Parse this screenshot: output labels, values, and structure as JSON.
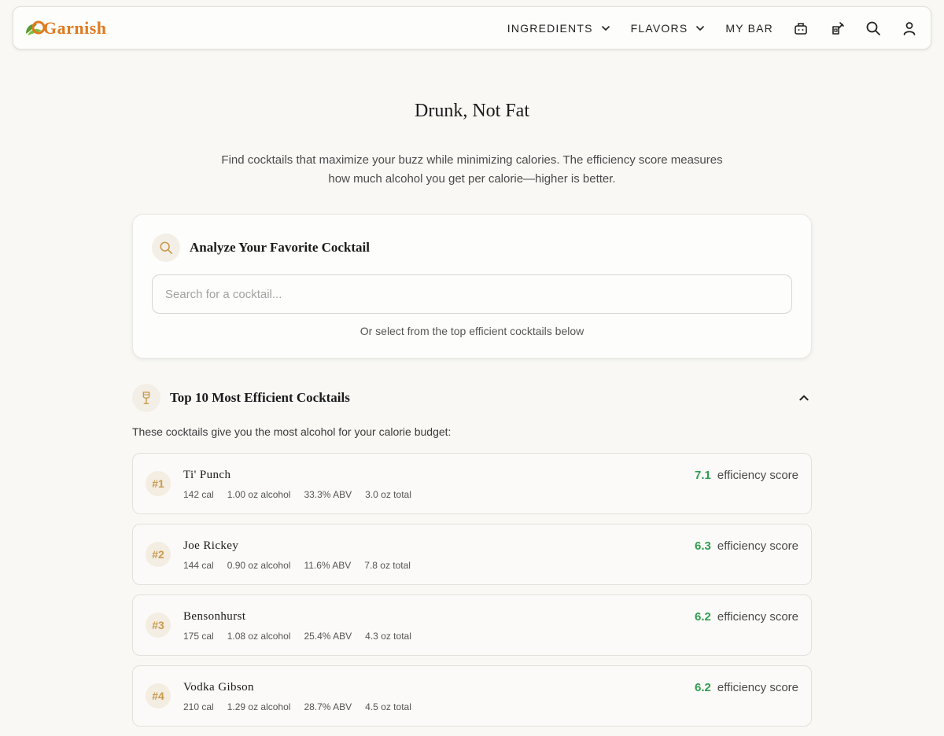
{
  "brand": {
    "name": "Garnish"
  },
  "nav": {
    "ingredients_label": "INGREDIENTS",
    "flavors_label": "FLAVORS",
    "my_bar_label": "MY BAR",
    "icons": [
      "shaker-icon",
      "bottle-icon",
      "search-icon",
      "user-icon"
    ]
  },
  "page": {
    "title": "Drunk, Not Fat",
    "intro": "Find cocktails that maximize your buzz while minimizing calories. The efficiency score measures how much alcohol you get per calorie—higher is better."
  },
  "analyze": {
    "title": "Analyze Your Favorite Cocktail",
    "search_placeholder": "Search for a cocktail...",
    "hint": "Or select from the top efficient cocktails below"
  },
  "top_list": {
    "title": "Top 10 Most Efficient Cocktails",
    "subtitle": "These cocktails give you the most alcohol for your calorie budget:",
    "score_label": "efficiency score",
    "items": [
      {
        "rank": "#1",
        "name": "Ti' Punch",
        "calories": "142 cal",
        "alcohol": "1.00 oz alcohol",
        "abv": "33.3% ABV",
        "total": "3.0 oz total",
        "score": "7.1"
      },
      {
        "rank": "#2",
        "name": "Joe Rickey",
        "calories": "144 cal",
        "alcohol": "0.90 oz alcohol",
        "abv": "11.6% ABV",
        "total": "7.8 oz total",
        "score": "6.3"
      },
      {
        "rank": "#3",
        "name": "Bensonhurst",
        "calories": "175 cal",
        "alcohol": "1.08 oz alcohol",
        "abv": "25.4% ABV",
        "total": "4.3 oz total",
        "score": "6.2"
      },
      {
        "rank": "#4",
        "name": "Vodka Gibson",
        "calories": "210 cal",
        "alcohol": "1.29 oz alcohol",
        "abv": "28.7% ABV",
        "total": "4.5 oz total",
        "score": "6.2"
      }
    ]
  },
  "colors": {
    "accent": "#e07a1f",
    "score_green": "#2e9d4f",
    "rank_gold": "#c99a4e",
    "background": "#f9f8f5"
  }
}
